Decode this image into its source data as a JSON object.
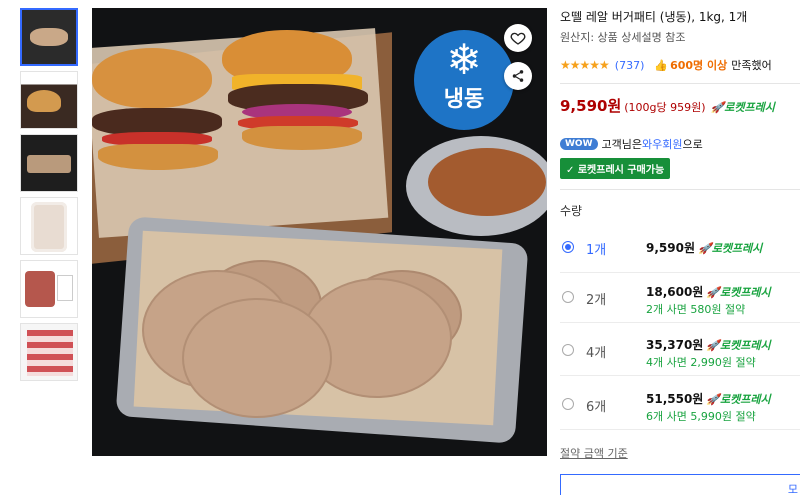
{
  "product": {
    "title": "오뗄 레알 버거패티 (냉동), 1kg, 1개",
    "origin": "원산지: 상품 상세설명 참조",
    "stars": "★★★★★",
    "review_count": "(737)",
    "satisfaction_icon": "👍",
    "satisfaction_count": "600명 이상",
    "satisfaction_label": "만족했어",
    "price": "9,590원",
    "unit_price": "(100g당 959원)",
    "rocket_label": "🚀로켓프레시",
    "frozen_badge": "냉동",
    "snowflake": "❄"
  },
  "membership": {
    "badge": "WOW",
    "text_prefix": "고객님은",
    "link": "와우회원",
    "text_suffix": "으로",
    "rocket_buy": "✓ 로켓프레시 구매가능"
  },
  "quantity": {
    "label": "수량",
    "options": [
      {
        "qty": "1개",
        "price": "9,590원",
        "rocket": "🚀로켓프레시",
        "save": "",
        "selected": true
      },
      {
        "qty": "2개",
        "price": "18,600원",
        "rocket": "🚀로켓프레시",
        "save": "2개 사면 580원 절약",
        "selected": false
      },
      {
        "qty": "4개",
        "price": "35,370원",
        "rocket": "🚀로켓프레시",
        "save": "4개 사면 2,990원 절약",
        "selected": false
      },
      {
        "qty": "6개",
        "price": "51,550원",
        "rocket": "🚀로켓프레시",
        "save": "6개 사면 5,990원 절약",
        "selected": false
      }
    ],
    "basis_link": "절약 금액 기준"
  },
  "box_edge_text": "모",
  "colors": {
    "accent": "#346aff",
    "price_red": "#ae0000",
    "rocket_green": "#18a33f",
    "star": "#f6a11c"
  }
}
